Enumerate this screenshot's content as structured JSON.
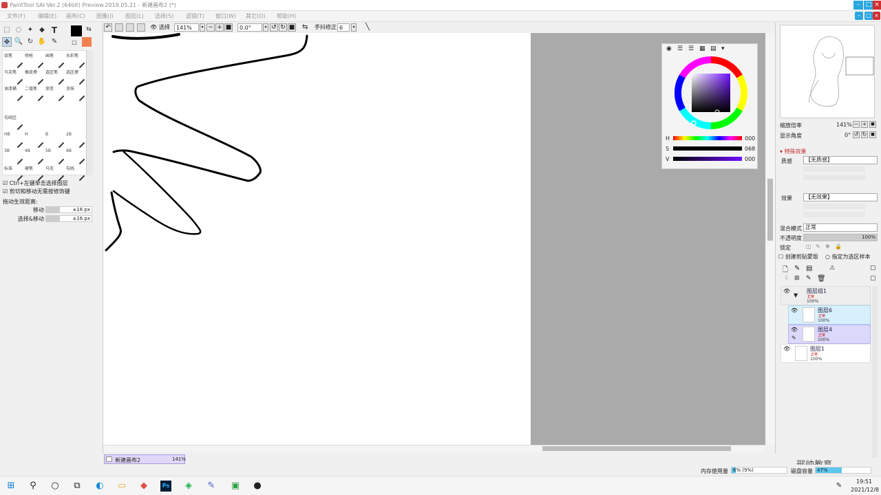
{
  "window": {
    "title": "PaintTool SAI Ver.2 (64bit) Preview.2019.05.21 - 新建画布2 (*)"
  },
  "menu": {
    "items": [
      "文件(F)",
      "编辑(E)",
      "画布(C)",
      "图像(I)",
      "图层(L)",
      "选择(S)",
      "滤镜(T)",
      "窗口(W)",
      "其它(O)",
      "帮助(H)"
    ]
  },
  "toolbar": {
    "select_label": "选择",
    "zoom": "141%",
    "rotation": "0.0°",
    "stabilizer_label": "手抖修正",
    "stabilizer_value": "6"
  },
  "tools": {
    "text_tool": "T"
  },
  "brushes": [
    {
      "name": "铅笔"
    },
    {
      "name": "喷枪"
    },
    {
      "name": "画笔"
    },
    {
      "name": "水彩笔"
    },
    {
      "name": "马克笔"
    },
    {
      "name": "橡皮擦"
    },
    {
      "name": "选区笔"
    },
    {
      "name": "选区擦"
    },
    {
      "name": "油漆桶"
    },
    {
      "name": "二值笔"
    },
    {
      "name": "渐变"
    },
    {
      "name": "涂抹"
    },
    {
      "name": "勾线区"
    },
    {
      "name": "HB"
    },
    {
      "name": "H"
    },
    {
      "name": "B"
    },
    {
      "name": "2B"
    },
    {
      "name": "3B"
    },
    {
      "name": "4B"
    },
    {
      "name": "5B"
    },
    {
      "name": "6B"
    },
    {
      "name": "标准"
    },
    {
      "name": "硬笔"
    },
    {
      "name": "马克"
    },
    {
      "name": "勾线"
    }
  ],
  "options": {
    "ctrl_click_label": "Ctrl+左键单击选择图层",
    "cut_move_label": "剪切和移动无需按修饰键",
    "drag_distance_label": "拖动生效距离:",
    "move_label": "移动",
    "move_value": "±16 px",
    "select_move_label": "选择&移动",
    "select_move_value": "±16 px"
  },
  "color": {
    "h_label": "H",
    "h_value": "000",
    "s_label": "S",
    "s_value": "068",
    "v_label": "V",
    "v_value": "000",
    "current": "#000000",
    "secondary": "#f08050"
  },
  "navigator": {
    "zoom_label": "缩放倍率",
    "zoom_value": "141%",
    "angle_label": "显示角度",
    "angle_value": "0°"
  },
  "effects": {
    "section_label": "特殊效果",
    "texture_label": "质感",
    "texture_value": "【无质感】",
    "effect_label": "效果",
    "effect_value": "【无效果】",
    "blend_label": "混合模式",
    "blend_value": "正常",
    "opacity_label": "不透明度",
    "opacity_value": "100%",
    "lock_label": "锁定",
    "clip_label": "创建剪贴蒙版",
    "selsrc_label": "指定为选区样本"
  },
  "layers": [
    {
      "name": "图层组1",
      "mode": "正常",
      "opacity": "100%"
    },
    {
      "name": "图层6",
      "mode": "正常",
      "opacity": "100%"
    },
    {
      "name": "图层4",
      "mode": "正常",
      "opacity": "100%"
    },
    {
      "name": "图层1",
      "mode": "正常",
      "opacity": "100%"
    }
  ],
  "canvas_tab": {
    "name": "新建画布2",
    "zoom": "141%"
  },
  "status": {
    "memory_label": "内存使用量",
    "memory_value": "6% (9%)",
    "disk_label": "磁盘容量",
    "disk_value": "47%",
    "disk_fill": 0.47,
    "watermark": "邢帅教育"
  },
  "taskbar": {
    "time": "19:51",
    "date": "2021/12/8"
  }
}
